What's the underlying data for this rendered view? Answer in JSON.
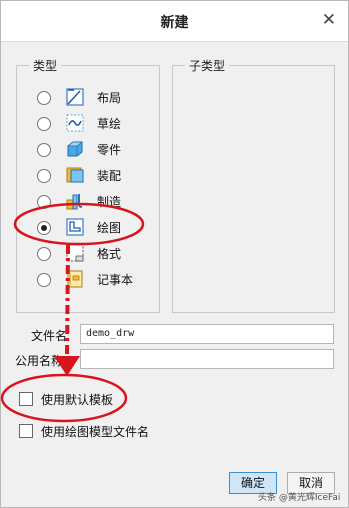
{
  "dialog": {
    "title": "新建",
    "close_glyph": "✕"
  },
  "type_group": {
    "title": "类型",
    "items": [
      {
        "label": "布局",
        "icon": "layout-icon",
        "selected": false
      },
      {
        "label": "草绘",
        "icon": "sketch-icon",
        "selected": false
      },
      {
        "label": "零件",
        "icon": "part-icon",
        "selected": false
      },
      {
        "label": "装配",
        "icon": "assembly-icon",
        "selected": false
      },
      {
        "label": "制造",
        "icon": "manufacturing-icon",
        "selected": false
      },
      {
        "label": "绘图",
        "icon": "drawing-icon",
        "selected": true
      },
      {
        "label": "格式",
        "icon": "format-icon",
        "selected": false
      },
      {
        "label": "记事本",
        "icon": "notebook-icon",
        "selected": false
      }
    ]
  },
  "subtype_group": {
    "title": "子类型"
  },
  "form": {
    "filename_label": "文件名",
    "filename_value": "demo_drw",
    "common_name_label": "公用名称",
    "common_name_value": ""
  },
  "options": {
    "use_default_template": "使用默认模板",
    "use_drawing_model_filename": "使用绘图模型文件名"
  },
  "buttons": {
    "ok": "确定",
    "cancel": "取消"
  },
  "watermark": "头条 @黄光辉IceFai",
  "colors": {
    "annotation": "#d8141c",
    "primary_button": "#cfe6f8"
  }
}
